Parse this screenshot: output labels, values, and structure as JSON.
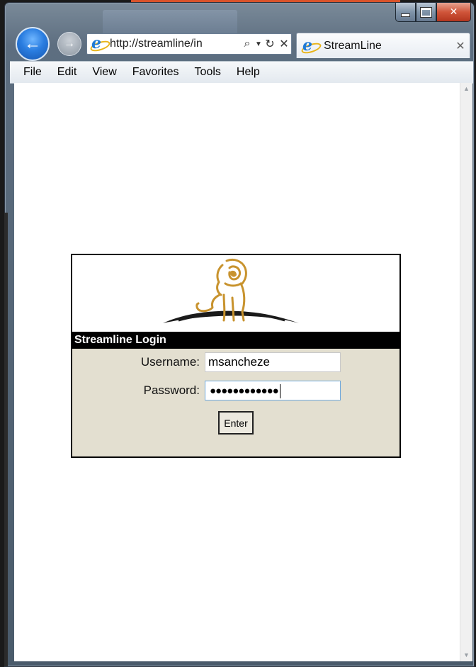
{
  "browser": {
    "address_url": "http://streamline/in",
    "tab_title": "StreamLine",
    "menu": [
      "File",
      "Edit",
      "View",
      "Favorites",
      "Tools",
      "Help"
    ]
  },
  "login": {
    "header": "Streamline Login",
    "username_label": "Username:",
    "username_value": "msancheze",
    "password_label": "Password:",
    "password_mask": "●●●●●●●●●●●●",
    "enter_label": "Enter"
  },
  "icons": {
    "back": "back-arrow-icon",
    "forward": "forward-arrow-icon",
    "search": "search-icon",
    "refresh": "refresh-icon",
    "stop": "stop-icon",
    "logo": "lion-logo-icon"
  },
  "colors": {
    "login_body": "#e3dfd0",
    "login_header": "#000000",
    "logo_gold": "#c8932e"
  }
}
